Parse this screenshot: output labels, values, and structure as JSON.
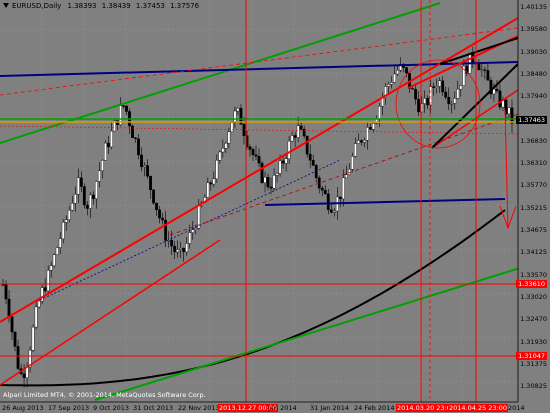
{
  "header": {
    "symbol": "EURUSD,Daily",
    "open": "1.38393",
    "high": "1.38439",
    "low": "1.37453",
    "close": "1.37576"
  },
  "price_axis": {
    "labels": [
      "1.40135",
      "1.39580",
      "1.39030",
      "1.38480",
      "1.37940",
      "1.37376",
      "1.36830",
      "1.36310",
      "1.35770",
      "1.35215",
      "1.34675",
      "1.34125",
      "1.33570",
      "1.33020",
      "1.32470",
      "1.31930",
      "1.31375",
      "1.30825"
    ],
    "current_price": "1.37463",
    "line_price_1": "1.33610",
    "line_price_2": "1.31047"
  },
  "date_axis": {
    "labels": [
      "26 Aug 2013",
      "17 Sep 2013",
      "9 Oct 2013",
      "31 Oct 2013",
      "22 Nov 2013",
      "2013.12.27 00:00",
      "Jan 2014",
      "31 Jan 2014",
      "24 Feb 2014",
      "2014.03.20 23:00",
      "2014.04.25 23:00",
      "2014"
    ],
    "highlighted": [
      "2013.12.27 00:00",
      "2014.03.20 23:00",
      "2014.04.25 23:00"
    ]
  },
  "copyright": "Alpari Limited MT4, © 2001-2014, MetaQuotes Software Corp.",
  "colors": {
    "background": "#808080",
    "red": "#ff0000",
    "green": "#00a000",
    "blue": "#000080",
    "black": "#000000",
    "bull_candle": "#ffffff",
    "bear_candle": "#000000"
  },
  "chart_data": {
    "type": "candlestick",
    "symbol": "EURUSD",
    "timeframe": "Daily",
    "ylim": [
      1.3062,
      1.4035
    ],
    "close_series": [
      1.335,
      1.331,
      1.323,
      1.316,
      1.312,
      1.315,
      1.321,
      1.327,
      1.332,
      1.335,
      1.338,
      1.342,
      1.346,
      1.349,
      1.353,
      1.357,
      1.36,
      1.358,
      1.355,
      1.357,
      1.361,
      1.365,
      1.369,
      1.372,
      1.375,
      1.378,
      1.38,
      1.376,
      1.372,
      1.369,
      1.365,
      1.361,
      1.358,
      1.354,
      1.35,
      1.347,
      1.345,
      1.343,
      1.342,
      1.344,
      1.347,
      1.35,
      1.353,
      1.356,
      1.359,
      1.362,
      1.365,
      1.369,
      1.373,
      1.376,
      1.378,
      1.376,
      1.372,
      1.369,
      1.366,
      1.363,
      1.361,
      1.36,
      1.361,
      1.363,
      1.366,
      1.369,
      1.372,
      1.374,
      1.372,
      1.369,
      1.366,
      1.362,
      1.359,
      1.357,
      1.355,
      1.355,
      1.357,
      1.36,
      1.364,
      1.367,
      1.37,
      1.372,
      1.374,
      1.376,
      1.378,
      1.381,
      1.384,
      1.386,
      1.388,
      1.389,
      1.388,
      1.385,
      1.382,
      1.38,
      1.379,
      1.381,
      1.384,
      1.386,
      1.385,
      1.383,
      1.381,
      1.383,
      1.386,
      1.389,
      1.391,
      1.392,
      1.39,
      1.387,
      1.385,
      1.383,
      1.381,
      1.38,
      1.378,
      1.376
    ]
  }
}
